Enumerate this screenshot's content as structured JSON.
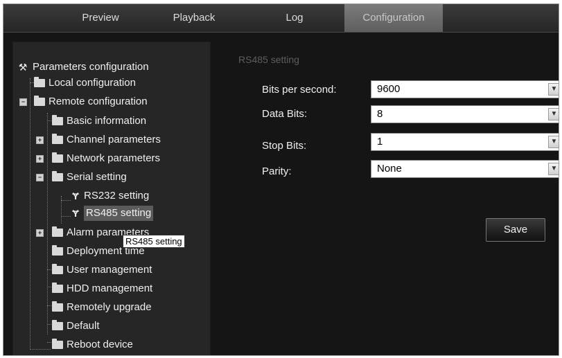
{
  "nav": {
    "tabs": [
      "Preview",
      "Playback",
      "Log",
      "Configuration"
    ],
    "active_tab": "Configuration"
  },
  "tree": {
    "root": "Parameters configuration",
    "local": "Local configuration",
    "remote": "Remote configuration",
    "basic": "Basic information",
    "channel": "Channel parameters",
    "network": "Network parameters",
    "serial": "Serial setting",
    "rs232": "RS232 setting",
    "rs485": "RS485 setting",
    "alarm": "Alarm parameters",
    "deployment": "Deployment time",
    "user": "User management",
    "hdd": "HDD management",
    "upgrade": "Remotely upgrade",
    "default": "Default",
    "reboot": "Reboot device"
  },
  "tooltip": "RS485 setting",
  "form": {
    "title": "RS485 setting",
    "bits_label": "Bits per second:",
    "bits_value": "9600",
    "data_label": "Data Bits:",
    "data_value": "8",
    "stop_label": "Stop Bits:",
    "stop_value": "1",
    "parity_label": "Parity:",
    "parity_value": "None",
    "save_label": "Save"
  },
  "colors": {
    "background": "#151515",
    "active_tab": "#6c6c6c",
    "selected_node": "#5b5b5b"
  }
}
